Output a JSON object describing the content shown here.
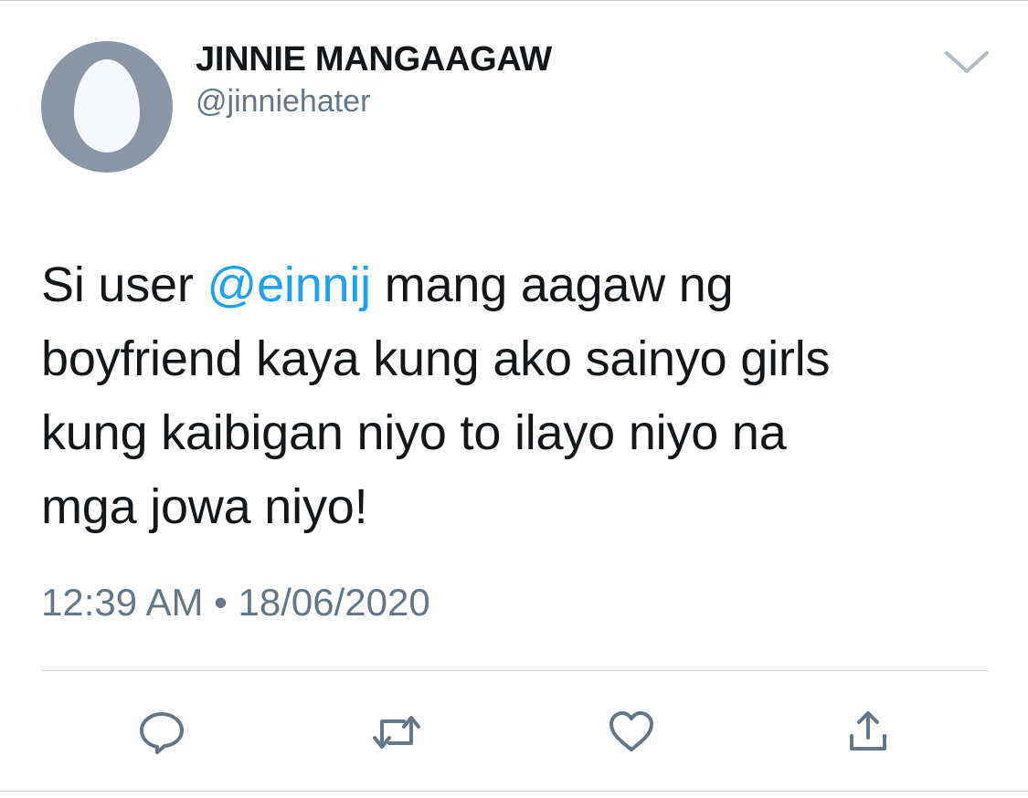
{
  "user": {
    "display_name": "JINNIE MANGAAGAW",
    "handle": "@jinniehater",
    "avatar_icon": "default-egg-avatar"
  },
  "tweet": {
    "text_prefix": "Si user ",
    "mention": "@einnij",
    "text_line1_suffix": " mang aagaw ng",
    "text_line2": "boyfriend kaya kung ako sainyo girls",
    "text_line3": "kung kaibigan niyo to ilayo niyo na",
    "text_line4": "mga jowa niyo!",
    "time": "12:39 AM",
    "separator": "•",
    "date": "18/06/2020"
  },
  "actions": [
    {
      "name": "reply",
      "icon": "reply-icon"
    },
    {
      "name": "retweet",
      "icon": "retweet-icon"
    },
    {
      "name": "like",
      "icon": "heart-icon"
    },
    {
      "name": "share",
      "icon": "share-icon"
    }
  ],
  "colors": {
    "text": "#14171a",
    "secondary": "#657786",
    "mention": "#1da1f2",
    "avatar_bg": "#8a96a3",
    "icon": "#657786"
  }
}
